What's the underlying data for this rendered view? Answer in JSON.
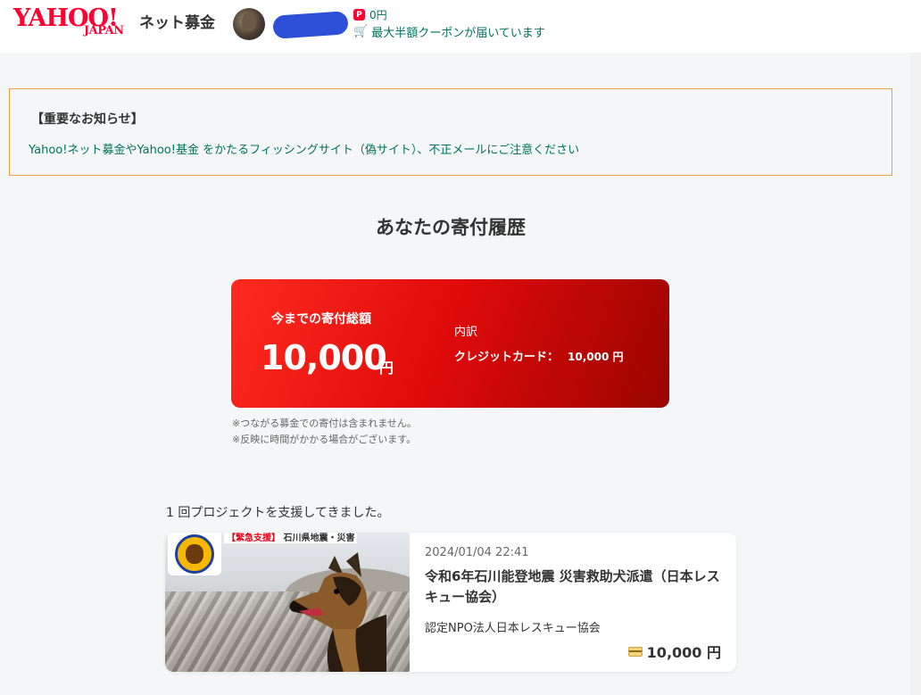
{
  "header": {
    "logo_main": "YAHOO!",
    "logo_sub": "JAPAN",
    "service_name": "ネット募金",
    "points_icon": "P",
    "points": "0円",
    "coupon_text": "最大半額クーポンが届いています"
  },
  "notice": {
    "title": "【重要なお知らせ】",
    "text": "Yahoo!ネット募金やYahoo!基金 をかたるフィッシングサイト（偽サイト）、不正メールにご注意ください"
  },
  "page_title": "あなたの寄付履歴",
  "total": {
    "label": "今までの寄付総額",
    "amount": "10,000",
    "unit": "円",
    "breakdown_label": "内訳",
    "breakdown_method": "クレジットカード：",
    "breakdown_value": "10,000 円"
  },
  "notes": [
    "※つながる募金での寄付は含まれません。",
    "※反映に時間がかかる場合がございます。"
  ],
  "support_count": "1 回プロジェクトを支援してきました。",
  "projects": [
    {
      "thumb_tag_emergency": "【緊急支援】",
      "thumb_tag_rest": "石川県地震・災害",
      "date": "2024/01/04 22:41",
      "title": "令和6年石川能登地震 災害救助犬派遣（日本レスキュー協会）",
      "org": "認定NPO法人日本レスキュー協会",
      "amount": "10,000 円"
    }
  ]
}
